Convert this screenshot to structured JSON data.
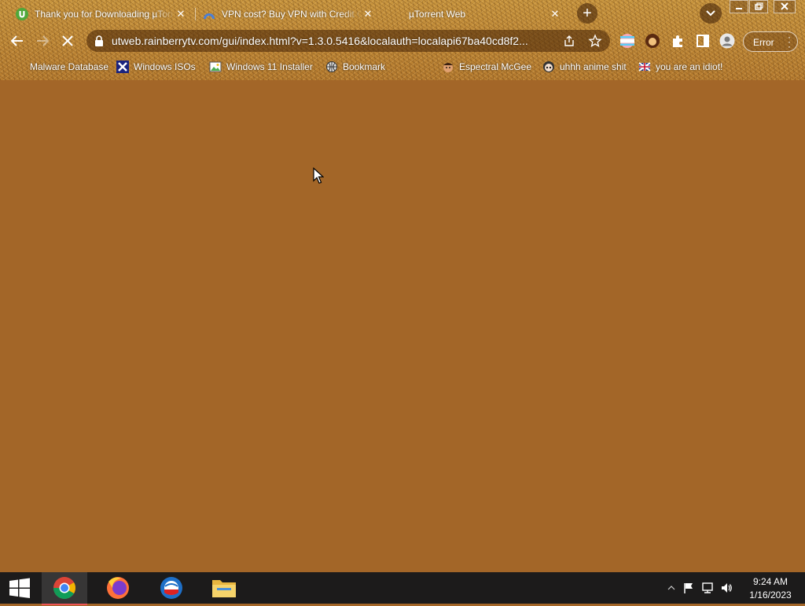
{
  "browser": {
    "tabs": [
      {
        "title": "Thank you for Downloading µTorrent",
        "icon": "utorrent-icon",
        "active": false
      },
      {
        "title": "VPN cost? Buy VPN with Credit Card",
        "icon": "vpn-icon",
        "active": false
      },
      {
        "title": "µTorrent Web",
        "icon": "none",
        "active": true
      }
    ],
    "new_tab_symbol": "+",
    "close_symbol": "✕",
    "url": "utweb.rainberrytv.com/gui/index.html?v=1.3.0.5416&localauth=localapi67ba40cd8f2...",
    "loading": true,
    "profile_label": "Error",
    "bookmarks": [
      {
        "label": "Malware Database",
        "icon": "none"
      },
      {
        "label": "Windows ISOs",
        "icon": "x-icon"
      },
      {
        "label": "Windows 11 Installer",
        "icon": "image-icon"
      },
      {
        "label": "Bookmark",
        "icon": "globe-icon"
      },
      {
        "label": "Espectral McGee",
        "icon": "face-icon"
      },
      {
        "label": "uhhh anime shit",
        "icon": "anime-face-icon"
      },
      {
        "label": "you are an idiot!",
        "icon": "flag-icon"
      }
    ]
  },
  "page": {
    "background": "#a36628"
  },
  "taskbar": {
    "apps": [
      "chrome-icon",
      "firefox-icon",
      "opera-icon",
      "file-explorer-icon"
    ],
    "time": "9:24 AM",
    "date": "1/16/2023"
  }
}
